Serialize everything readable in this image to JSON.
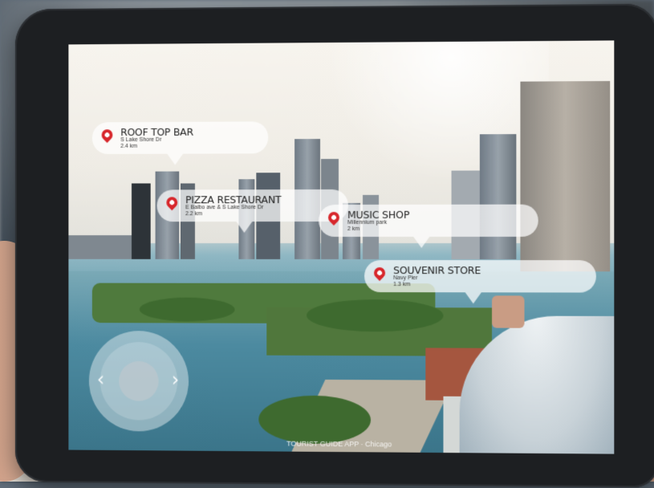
{
  "callouts": [
    {
      "name": "ROOF TOP BAR",
      "address": "S Lake Shore Dr",
      "distance": "2.4 km"
    },
    {
      "name": "PIZZA RESTAURANT",
      "address": "E Balbo ave & S Lake Shore Dr",
      "distance": "2.2 km"
    },
    {
      "name": "MUSIC SHOP",
      "address": "Millennium park",
      "distance": "2 km"
    },
    {
      "name": "SOUVENIR STORE",
      "address": "Navy Pier",
      "distance": "1.3 km"
    }
  ],
  "footer": "TOURIST GUIDE APP · Chicago",
  "joystick": {
    "left_arrow": "‹",
    "right_arrow": "›"
  },
  "colors": {
    "pin": "#d7262b",
    "bubble": "rgba(255,255,255,0.72)"
  }
}
